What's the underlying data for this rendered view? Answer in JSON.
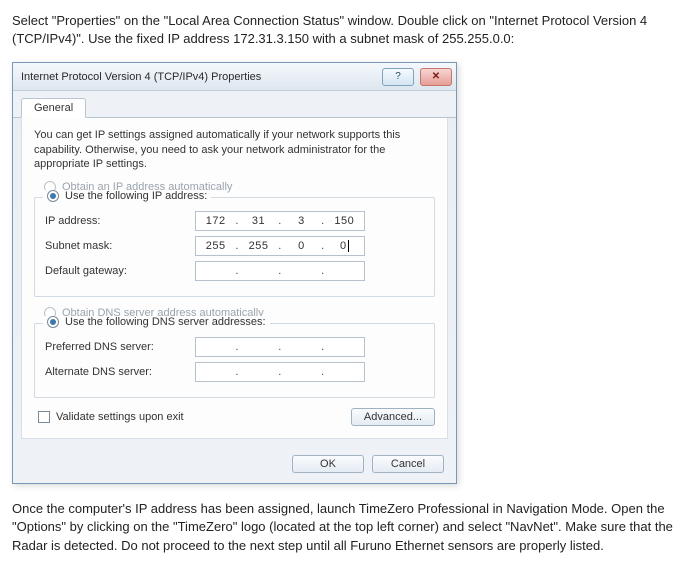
{
  "instruction_top": "Select \"Properties\" on the \"Local Area Connection Status\" window. Double click on \"Internet Protocol Version 4 (TCP/IPv4)\". Use the fixed IP address 172.31.3.150 with a subnet mask of 255.255.0.0:",
  "instruction_bottom": "Once the computer's IP address has been assigned, launch TimeZero Professional in Navigation Mode. Open the \"Options\" by clicking on the \"TimeZero\" logo (located at the top left corner) and select \"NavNet\". Make sure that the Radar is detected. Do not proceed to the next step until all Furuno Ethernet sensors are properly listed.",
  "dialog": {
    "title": "Internet Protocol Version 4 (TCP/IPv4) Properties",
    "help_glyph": "?",
    "close_glyph": "✕",
    "tab_general": "General",
    "description": "You can get IP settings assigned automatically if your network supports this capability. Otherwise, you need to ask your network administrator for the appropriate IP settings.",
    "radio_ip_auto": "Obtain an IP address automatically",
    "radio_ip_manual": "Use the following IP address:",
    "label_ip": "IP address:",
    "label_subnet": "Subnet mask:",
    "label_gateway": "Default gateway:",
    "ip": {
      "a": "172",
      "b": "31",
      "c": "3",
      "d": "150"
    },
    "subnet": {
      "a": "255",
      "b": "255",
      "c": "0",
      "d": "0"
    },
    "radio_dns_auto": "Obtain DNS server address automatically",
    "radio_dns_manual": "Use the following DNS server addresses:",
    "label_pref_dns": "Preferred DNS server:",
    "label_alt_dns": "Alternate DNS server:",
    "validate_label": "Validate settings upon exit",
    "btn_advanced": "Advanced...",
    "btn_ok": "OK",
    "btn_cancel": "Cancel"
  }
}
